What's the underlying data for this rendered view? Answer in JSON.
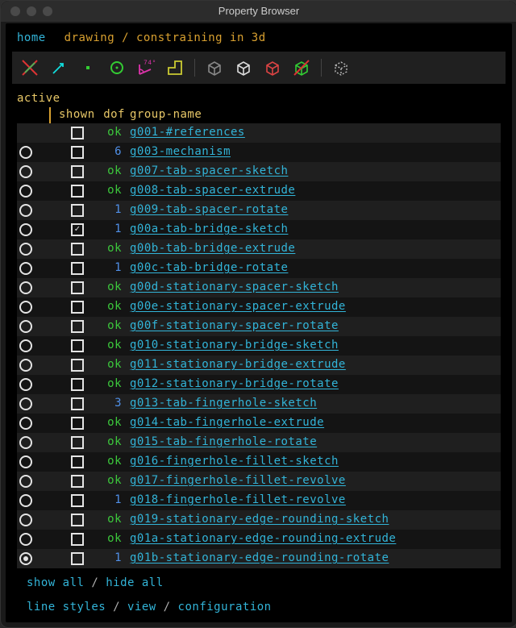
{
  "window": {
    "title": "Property Browser"
  },
  "nav": {
    "home": "home",
    "path": "drawing / constraining in 3d"
  },
  "toolbar_icons": [
    "no-intersection-icon",
    "vector-icon",
    "point-icon",
    "circle-icon",
    "angle-74-icon",
    "step-icon",
    "sep",
    "cube-grey-icon",
    "cube-white-icon",
    "cube-red-icon",
    "cube-green-icon",
    "sep",
    "wireframe-cube-icon"
  ],
  "headers": {
    "active": "active",
    "shown": "shown",
    "dof": "dof",
    "group": "group-name"
  },
  "groups": [
    {
      "active": false,
      "shown": false,
      "dof": "ok",
      "name": "g001-#references",
      "radio": false
    },
    {
      "active": true,
      "shown": false,
      "dof": "6",
      "name": "g003-mechanism"
    },
    {
      "active": true,
      "shown": false,
      "dof": "ok",
      "name": "g007-tab-spacer-sketch"
    },
    {
      "active": true,
      "shown": false,
      "dof": "ok",
      "name": "g008-tab-spacer-extrude"
    },
    {
      "active": true,
      "shown": false,
      "dof": "1",
      "name": "g009-tab-spacer-rotate"
    },
    {
      "active": true,
      "shown": true,
      "dof": "1",
      "name": "g00a-tab-bridge-sketch"
    },
    {
      "active": true,
      "shown": false,
      "dof": "ok",
      "name": "g00b-tab-bridge-extrude"
    },
    {
      "active": true,
      "shown": false,
      "dof": "1",
      "name": "g00c-tab-bridge-rotate"
    },
    {
      "active": true,
      "shown": false,
      "dof": "ok",
      "name": "g00d-stationary-spacer-sketch"
    },
    {
      "active": true,
      "shown": false,
      "dof": "ok",
      "name": "g00e-stationary-spacer-extrude"
    },
    {
      "active": true,
      "shown": false,
      "dof": "ok",
      "name": "g00f-stationary-spacer-rotate"
    },
    {
      "active": true,
      "shown": false,
      "dof": "ok",
      "name": "g010-stationary-bridge-sketch"
    },
    {
      "active": true,
      "shown": false,
      "dof": "ok",
      "name": "g011-stationary-bridge-extrude"
    },
    {
      "active": true,
      "shown": false,
      "dof": "ok",
      "name": "g012-stationary-bridge-rotate"
    },
    {
      "active": true,
      "shown": false,
      "dof": "3",
      "name": "g013-tab-fingerhole-sketch"
    },
    {
      "active": true,
      "shown": false,
      "dof": "ok",
      "name": "g014-tab-fingerhole-extrude"
    },
    {
      "active": true,
      "shown": false,
      "dof": "ok",
      "name": "g015-tab-fingerhole-rotate"
    },
    {
      "active": true,
      "shown": false,
      "dof": "ok",
      "name": "g016-fingerhole-fillet-sketch"
    },
    {
      "active": true,
      "shown": false,
      "dof": "ok",
      "name": "g017-fingerhole-fillet-revolve"
    },
    {
      "active": true,
      "shown": false,
      "dof": "1",
      "name": "g018-fingerhole-fillet-revolve"
    },
    {
      "active": true,
      "shown": false,
      "dof": "ok",
      "name": "g019-stationary-edge-rounding-sketch"
    },
    {
      "active": true,
      "shown": false,
      "dof": "ok",
      "name": "g01a-stationary-edge-rounding-extrude"
    },
    {
      "active": true,
      "shown": false,
      "dof": "1",
      "name": "g01b-stationary-edge-rounding-rotate",
      "selected": true
    }
  ],
  "footer": {
    "show_all": "show all",
    "hide_all": "hide all",
    "line_styles": "line styles",
    "view": "view",
    "configuration": "configuration",
    "slash": " / "
  }
}
